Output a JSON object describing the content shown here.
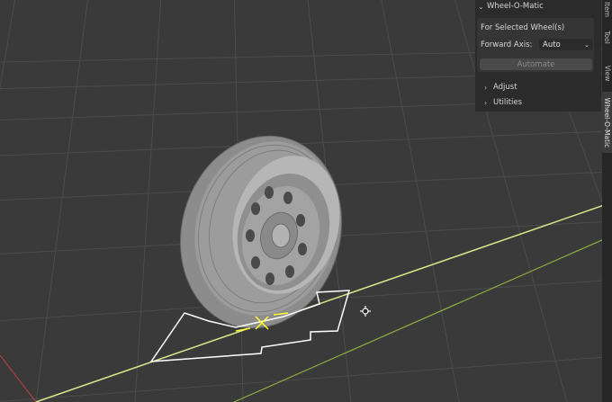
{
  "panel": {
    "title": "Wheel-O-Matic",
    "section_label": "For Selected Wheel(s)",
    "forward_axis_label": "Forward Axis:",
    "forward_axis_value": "Auto",
    "automate_label": "Automate",
    "adjust_label": "Adjust",
    "utilities_label": "Utilities"
  },
  "tabs": [
    {
      "label": "Item"
    },
    {
      "label": "Tool"
    },
    {
      "label": "View"
    },
    {
      "label": "Wheel-O-Matic"
    }
  ],
  "icons": {
    "panel_collapse": "chevron-down-icon",
    "subpanel_expand": "chevron-right-icon",
    "select_arrow": "chevron-down-icon",
    "cursor": "move-cursor-icon"
  },
  "colors": {
    "background": "#3a3a3a",
    "grid": "#4a4a4a",
    "x_axis": "#d7e98a",
    "y_axis": "#8cb040",
    "gizmo": "#ffffff",
    "selection": "#ffff30",
    "panel_bg": "#2a2a2a"
  }
}
